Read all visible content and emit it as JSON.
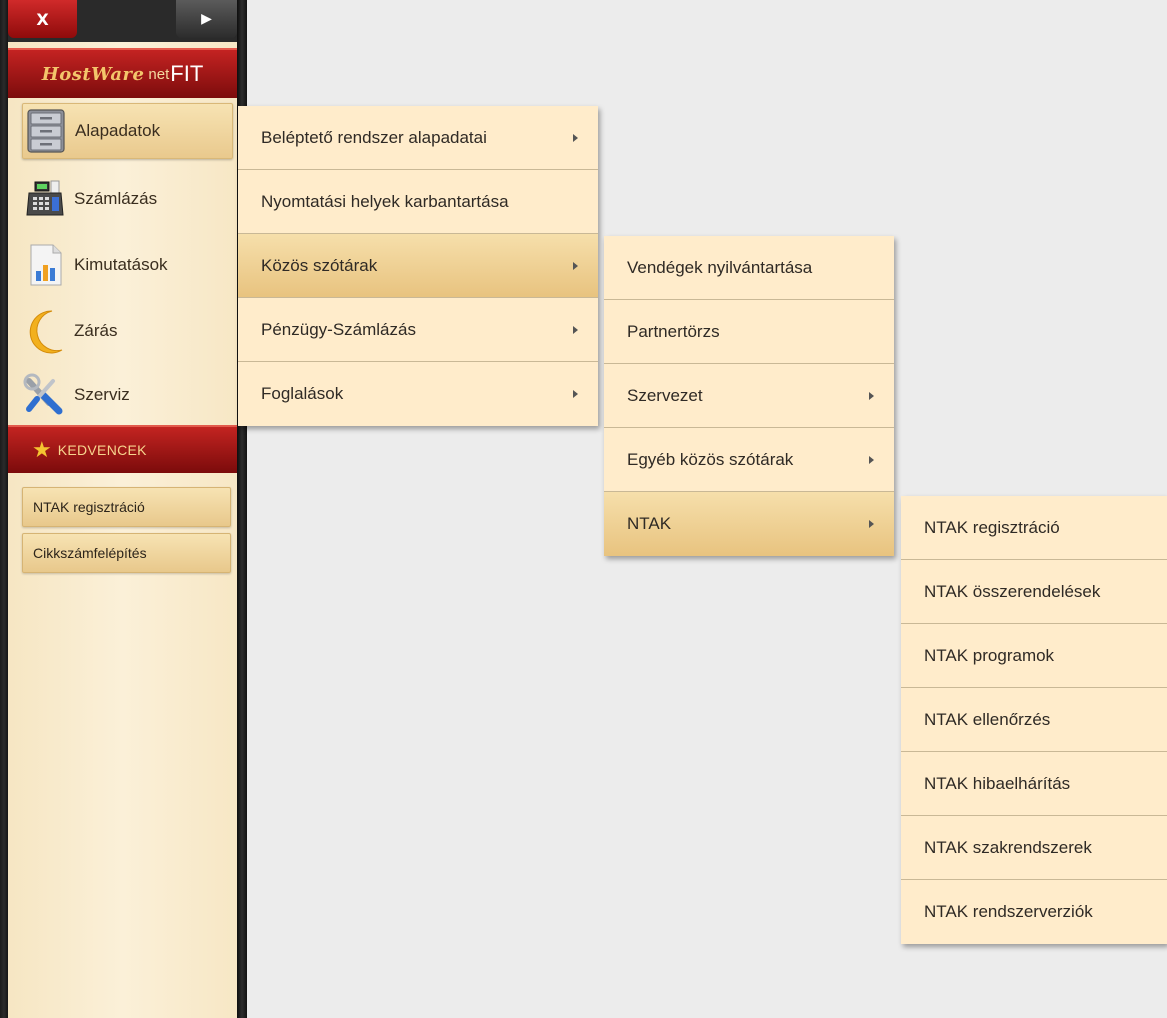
{
  "window": {
    "close_label": "X",
    "expand_label": "▶"
  },
  "logo": {
    "script": "HostWare",
    "net": "net",
    "fit": "FIT"
  },
  "sidebar": {
    "items": [
      {
        "label": "Alapadatok",
        "icon": "cabinet-icon",
        "active": true
      },
      {
        "label": "Számlázás",
        "icon": "cash-register-icon"
      },
      {
        "label": "Kimutatások",
        "icon": "report-chart-icon"
      },
      {
        "label": "Zárás",
        "icon": "moon-icon"
      },
      {
        "label": "Szerviz",
        "icon": "tools-icon"
      }
    ]
  },
  "favorites": {
    "title": "KEDVENCEK",
    "items": [
      "NTAK regisztráció",
      "Cikkszámfelépítés"
    ]
  },
  "menu1": {
    "items": [
      {
        "label": "Beléptető rendszer alapadatai",
        "submenu": true
      },
      {
        "label": "Nyomtatási helyek karbantartása",
        "submenu": false
      },
      {
        "label": "Közös szótárak",
        "submenu": true,
        "active": true
      },
      {
        "label": "Pénzügy-Számlázás",
        "submenu": true
      },
      {
        "label": "Foglalások",
        "submenu": true
      }
    ]
  },
  "menu2": {
    "items": [
      {
        "label": "Vendégek nyilvántartása",
        "submenu": false
      },
      {
        "label": "Partnertörzs",
        "submenu": false
      },
      {
        "label": "Szervezet",
        "submenu": true
      },
      {
        "label": "Egyéb közös szótárak",
        "submenu": true
      },
      {
        "label": "NTAK",
        "submenu": true,
        "active": true
      }
    ]
  },
  "menu3": {
    "items": [
      "NTAK regisztráció",
      "NTAK összerendelések",
      "NTAK programok",
      "NTAK ellenőrzés",
      "NTAK hibaelhárítás",
      "NTAK szakrendszerek",
      "NTAK rendszerverziók"
    ]
  }
}
